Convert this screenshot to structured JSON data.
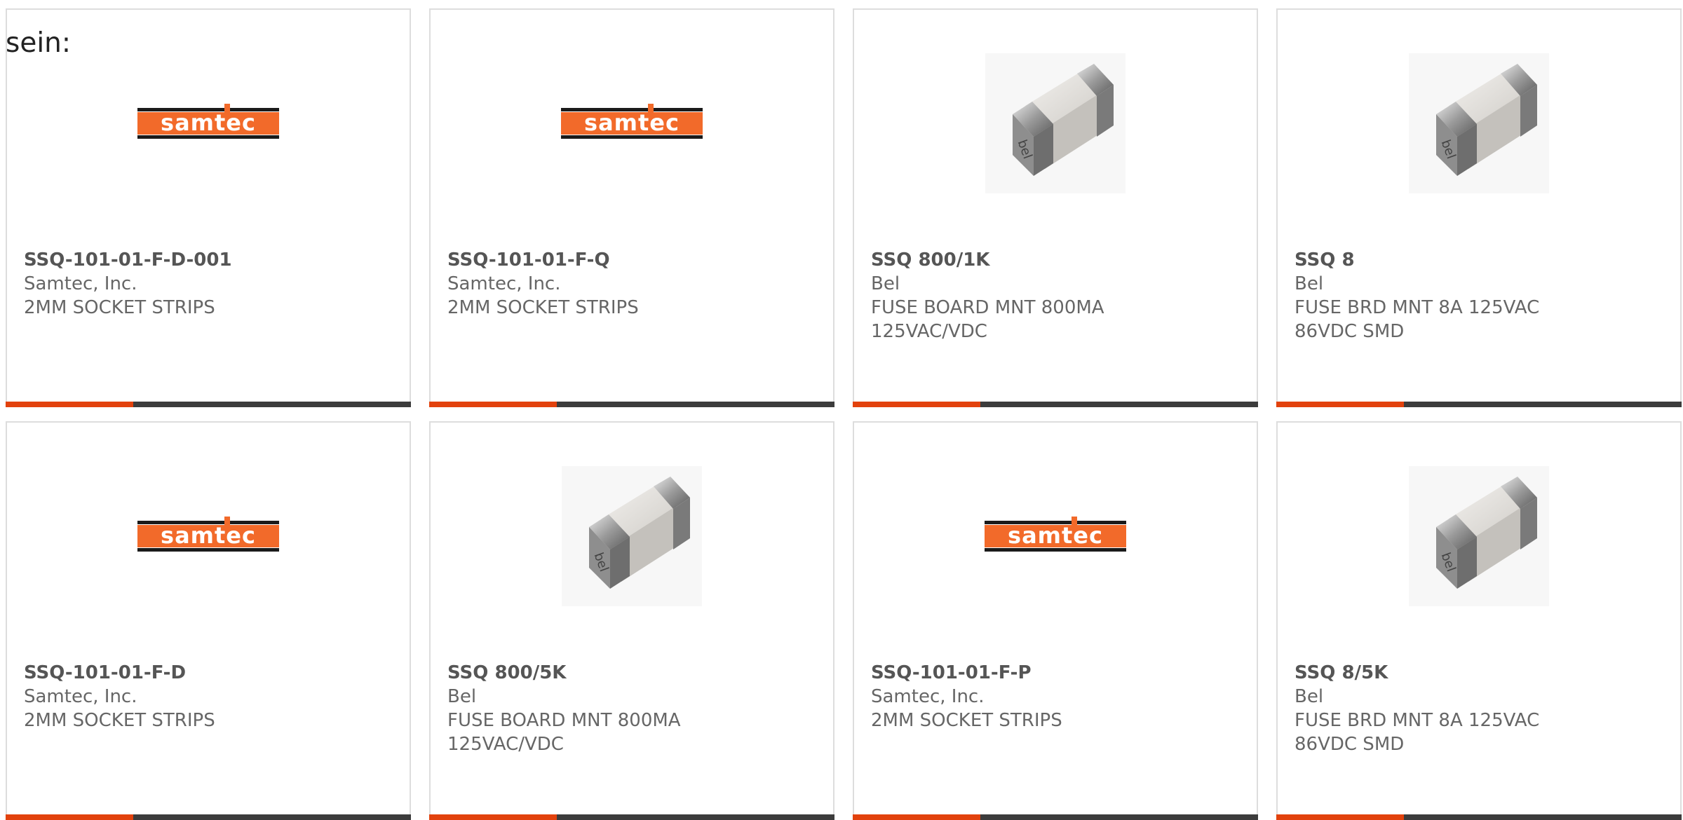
{
  "intro_text": "sein:",
  "colors": {
    "accent": "#e2420d",
    "bar": "#3c3c3c",
    "samtec_orange": "#f26a2a"
  },
  "products": [
    {
      "part_number": "SSQ-101-01-F-D-001",
      "manufacturer": "Samtec, Inc.",
      "description": [
        "2MM SOCKET STRIPS"
      ],
      "image": "samtec-logo"
    },
    {
      "part_number": "SSQ-101-01-F-Q",
      "manufacturer": "Samtec, Inc.",
      "description": [
        "2MM SOCKET STRIPS"
      ],
      "image": "samtec-logo"
    },
    {
      "part_number": "SSQ 800/1K",
      "manufacturer": "Bel",
      "description": [
        "FUSE BOARD MNT 800MA",
        "125VAC/VDC"
      ],
      "image": "fuse-photo"
    },
    {
      "part_number": "SSQ 8",
      "manufacturer": "Bel",
      "description": [
        "FUSE BRD MNT 8A 125VAC",
        "86VDC SMD"
      ],
      "image": "fuse-photo"
    },
    {
      "part_number": "SSQ-101-01-F-D",
      "manufacturer": "Samtec, Inc.",
      "description": [
        "2MM SOCKET STRIPS"
      ],
      "image": "samtec-logo"
    },
    {
      "part_number": "SSQ 800/5K",
      "manufacturer": "Bel",
      "description": [
        "FUSE BOARD MNT 800MA",
        "125VAC/VDC"
      ],
      "image": "fuse-photo"
    },
    {
      "part_number": "SSQ-101-01-F-P",
      "manufacturer": "Samtec, Inc.",
      "description": [
        "2MM SOCKET STRIPS"
      ],
      "image": "samtec-logo"
    },
    {
      "part_number": "SSQ 8/5K",
      "manufacturer": "Bel",
      "description": [
        "FUSE BRD MNT 8A 125VAC",
        "86VDC SMD"
      ],
      "image": "fuse-photo"
    }
  ]
}
